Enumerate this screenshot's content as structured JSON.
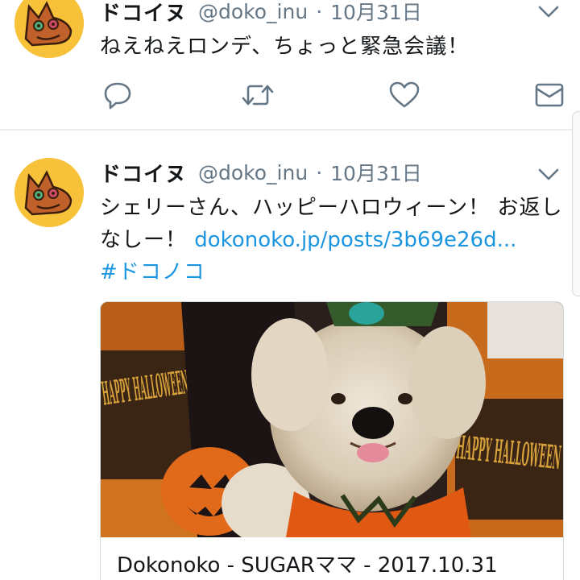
{
  "tweets": [
    {
      "display_name": "ドコイヌ",
      "handle": "@doko_inu",
      "separator": "·",
      "date": "10月31日",
      "text": "ねえねえロンデ、ちょっと緊急会議！"
    },
    {
      "display_name": "ドコイヌ",
      "handle": "@doko_inu",
      "separator": "·",
      "date": "10月31日",
      "text": "シェリーさん、ハッピーハロウィーン！ お返しなしー！ ",
      "link": "dokonoko.jp/posts/3b69e26d...",
      "hashtag": "#ドコノコ",
      "card": {
        "title": "Dokonoko - SUGARママ - 2017.10.31",
        "banner_left": "HAPPY HALLOWEEN",
        "banner_right": "HAPPY HALLOWEEN"
      }
    }
  ],
  "icons": {
    "reply": "reply-icon",
    "retweet": "retweet-icon",
    "like": "heart-icon",
    "dm": "envelope-icon",
    "more": "chevron-down-icon"
  },
  "colors": {
    "link": "#1b95e0",
    "secondary_text": "#657786",
    "avatar_bg": "#f7c23a",
    "divider": "#e6ecf0"
  }
}
